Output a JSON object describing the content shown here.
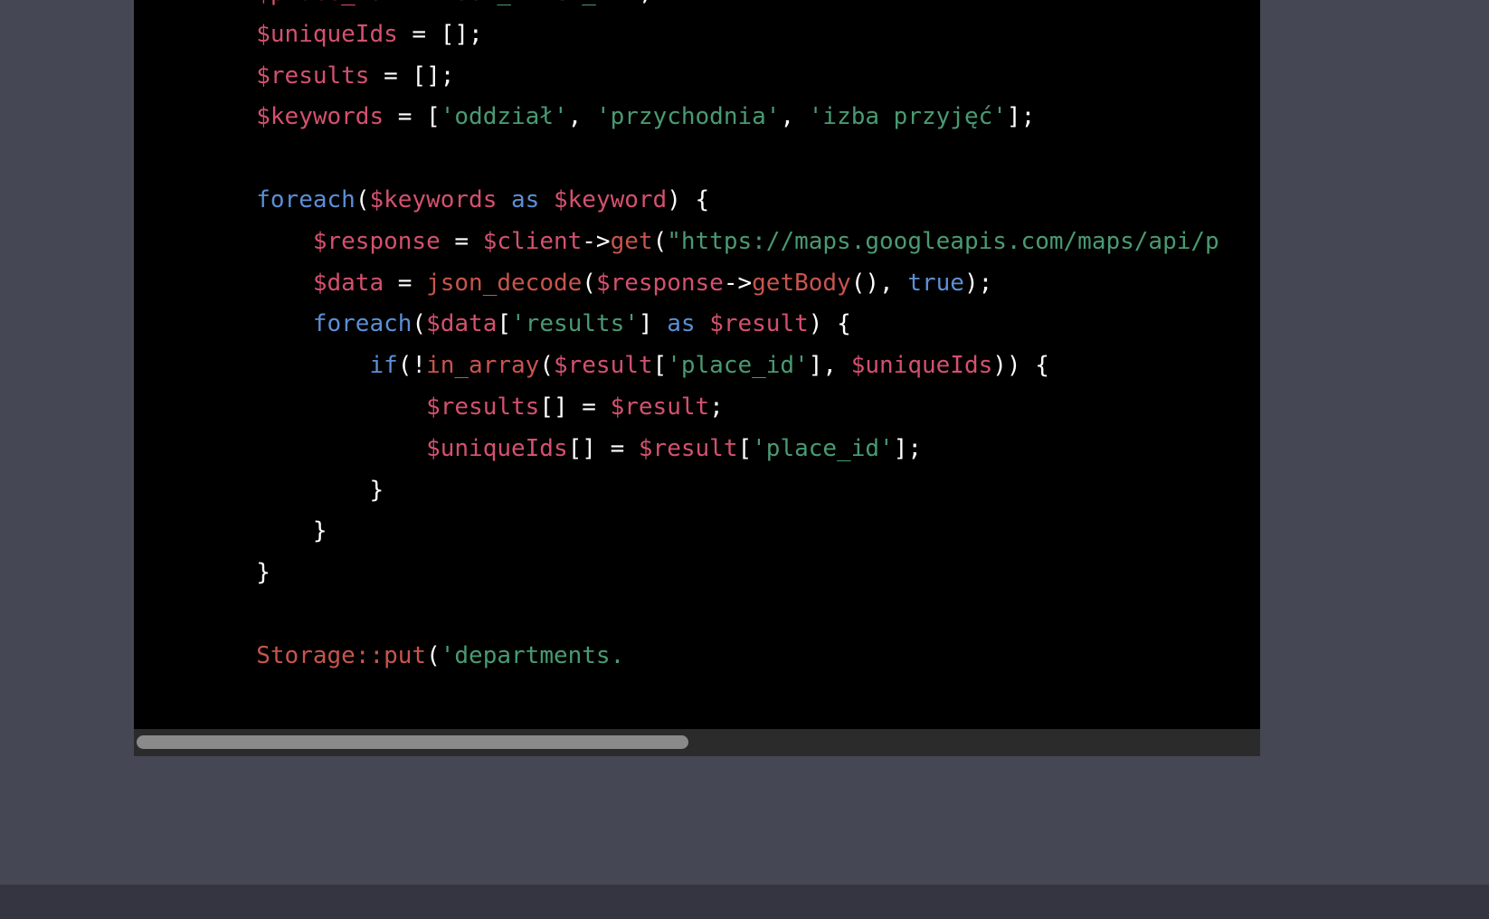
{
  "window": {
    "background_color": "#454754",
    "bottom_strip_color": "#343541"
  },
  "code_block": {
    "language": "php",
    "background_color": "#000000",
    "clipped_right": true,
    "scrollbar": {
      "orientation": "horizontal",
      "track_color": "#2b2b2b",
      "thumb_color": "#8a8a8a",
      "thumb_position_percent": 0,
      "thumb_width_percent": 49
    },
    "theme_colors": {
      "variable": "#d4516e",
      "string": "#4a9a72",
      "keyword": "#5c8fd6",
      "function": "#c8554c",
      "class": "#c8554c",
      "punctuation": "#ffffff"
    },
    "lines": [
      {
        "n": 1,
        "text": "        $place_id = 'YOUR_PLACE_ID';",
        "tokens": [
          {
            "t": "        ",
            "c": "plain"
          },
          {
            "t": "$place_id",
            "c": "var"
          },
          {
            "t": " = ",
            "c": "punct"
          },
          {
            "t": "'YOUR_PLACE_ID'",
            "c": "str"
          },
          {
            "t": ";",
            "c": "punct"
          }
        ]
      },
      {
        "n": 2,
        "text": "        $uniqueIds = [];",
        "tokens": [
          {
            "t": "        ",
            "c": "plain"
          },
          {
            "t": "$uniqueIds",
            "c": "var"
          },
          {
            "t": " = [];",
            "c": "punct"
          }
        ]
      },
      {
        "n": 3,
        "text": "        $results = [];",
        "tokens": [
          {
            "t": "        ",
            "c": "plain"
          },
          {
            "t": "$results",
            "c": "var"
          },
          {
            "t": " = [];",
            "c": "punct"
          }
        ]
      },
      {
        "n": 4,
        "text": "        $keywords = ['oddział', 'przychodnia', 'izba przyjęć'];",
        "tokens": [
          {
            "t": "        ",
            "c": "plain"
          },
          {
            "t": "$keywords",
            "c": "var"
          },
          {
            "t": " = [",
            "c": "punct"
          },
          {
            "t": "'oddział'",
            "c": "str"
          },
          {
            "t": ", ",
            "c": "punct"
          },
          {
            "t": "'przychodnia'",
            "c": "str"
          },
          {
            "t": ", ",
            "c": "punct"
          },
          {
            "t": "'izba przyjęć'",
            "c": "str"
          },
          {
            "t": "];",
            "c": "punct"
          }
        ]
      },
      {
        "n": 5,
        "text": "",
        "tokens": []
      },
      {
        "n": 6,
        "text": "        foreach($keywords as $keyword) {",
        "tokens": [
          {
            "t": "        ",
            "c": "plain"
          },
          {
            "t": "foreach",
            "c": "kw"
          },
          {
            "t": "(",
            "c": "punct"
          },
          {
            "t": "$keywords",
            "c": "var"
          },
          {
            "t": " ",
            "c": "punct"
          },
          {
            "t": "as",
            "c": "kw"
          },
          {
            "t": " ",
            "c": "punct"
          },
          {
            "t": "$keyword",
            "c": "var"
          },
          {
            "t": ") {",
            "c": "punct"
          }
        ]
      },
      {
        "n": 7,
        "text": "            $response = $client->get(\"https://maps.googleapis.com/maps/api/p",
        "tokens": [
          {
            "t": "            ",
            "c": "plain"
          },
          {
            "t": "$response",
            "c": "var"
          },
          {
            "t": " = ",
            "c": "punct"
          },
          {
            "t": "$client",
            "c": "var"
          },
          {
            "t": "->",
            "c": "punct"
          },
          {
            "t": "get",
            "c": "fn"
          },
          {
            "t": "(",
            "c": "punct"
          },
          {
            "t": "\"https://maps.googleapis.com/maps/api/p",
            "c": "str"
          }
        ]
      },
      {
        "n": 8,
        "text": "            $data = json_decode($response->getBody(), true);",
        "tokens": [
          {
            "t": "            ",
            "c": "plain"
          },
          {
            "t": "$data",
            "c": "var"
          },
          {
            "t": " = ",
            "c": "punct"
          },
          {
            "t": "json_decode",
            "c": "fn"
          },
          {
            "t": "(",
            "c": "punct"
          },
          {
            "t": "$response",
            "c": "var"
          },
          {
            "t": "->",
            "c": "punct"
          },
          {
            "t": "getBody",
            "c": "fn"
          },
          {
            "t": "(), ",
            "c": "punct"
          },
          {
            "t": "true",
            "c": "kw"
          },
          {
            "t": ");",
            "c": "punct"
          }
        ]
      },
      {
        "n": 9,
        "text": "            foreach($data['results'] as $result) {",
        "tokens": [
          {
            "t": "            ",
            "c": "plain"
          },
          {
            "t": "foreach",
            "c": "kw"
          },
          {
            "t": "(",
            "c": "punct"
          },
          {
            "t": "$data",
            "c": "var"
          },
          {
            "t": "[",
            "c": "punct"
          },
          {
            "t": "'results'",
            "c": "str"
          },
          {
            "t": "] ",
            "c": "punct"
          },
          {
            "t": "as",
            "c": "kw"
          },
          {
            "t": " ",
            "c": "punct"
          },
          {
            "t": "$result",
            "c": "var"
          },
          {
            "t": ") {",
            "c": "punct"
          }
        ]
      },
      {
        "n": 10,
        "text": "                if(!in_array($result['place_id'], $uniqueIds)) {",
        "tokens": [
          {
            "t": "                ",
            "c": "plain"
          },
          {
            "t": "if",
            "c": "kw"
          },
          {
            "t": "(!",
            "c": "punct"
          },
          {
            "t": "in_array",
            "c": "fn"
          },
          {
            "t": "(",
            "c": "punct"
          },
          {
            "t": "$result",
            "c": "var"
          },
          {
            "t": "[",
            "c": "punct"
          },
          {
            "t": "'place_id'",
            "c": "str"
          },
          {
            "t": "], ",
            "c": "punct"
          },
          {
            "t": "$uniqueIds",
            "c": "var"
          },
          {
            "t": ")) {",
            "c": "punct"
          }
        ]
      },
      {
        "n": 11,
        "text": "                    $results[] = $result;",
        "tokens": [
          {
            "t": "                    ",
            "c": "plain"
          },
          {
            "t": "$results",
            "c": "var"
          },
          {
            "t": "[] = ",
            "c": "punct"
          },
          {
            "t": "$result",
            "c": "var"
          },
          {
            "t": ";",
            "c": "punct"
          }
        ]
      },
      {
        "n": 12,
        "text": "                    $uniqueIds[] = $result['place_id'];",
        "tokens": [
          {
            "t": "                    ",
            "c": "plain"
          },
          {
            "t": "$uniqueIds",
            "c": "var"
          },
          {
            "t": "[] = ",
            "c": "punct"
          },
          {
            "t": "$result",
            "c": "var"
          },
          {
            "t": "[",
            "c": "punct"
          },
          {
            "t": "'place_id'",
            "c": "str"
          },
          {
            "t": "];",
            "c": "punct"
          }
        ]
      },
      {
        "n": 13,
        "text": "                }",
        "tokens": [
          {
            "t": "                ",
            "c": "plain"
          },
          {
            "t": "}",
            "c": "punct"
          }
        ]
      },
      {
        "n": 14,
        "text": "            }",
        "tokens": [
          {
            "t": "            ",
            "c": "plain"
          },
          {
            "t": "}",
            "c": "punct"
          }
        ]
      },
      {
        "n": 15,
        "text": "        }",
        "tokens": [
          {
            "t": "        ",
            "c": "plain"
          },
          {
            "t": "}",
            "c": "punct"
          }
        ]
      },
      {
        "n": 16,
        "text": "",
        "tokens": []
      },
      {
        "n": 17,
        "text": "        Storage::put('departments.",
        "tokens": [
          {
            "t": "        ",
            "c": "plain"
          },
          {
            "t": "Storage",
            "c": "cls"
          },
          {
            "t": "::",
            "c": "cls"
          },
          {
            "t": "put",
            "c": "cls"
          },
          {
            "t": "(",
            "c": "punct"
          },
          {
            "t": "'departments.",
            "c": "str"
          }
        ]
      }
    ]
  }
}
